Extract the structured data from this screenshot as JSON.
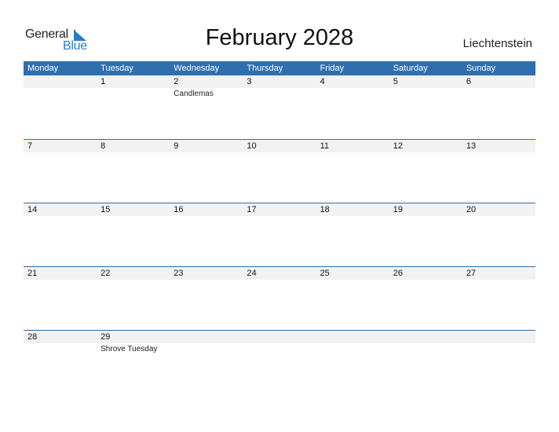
{
  "logo": {
    "word1": "General",
    "word2": "Blue"
  },
  "title": "February 2028",
  "country": "Liechtenstein",
  "colors": {
    "accent": "#2e6fb0",
    "logo_blue": "#2a7bc8",
    "row_shade": "#f2f2f2"
  },
  "weekdays": [
    "Monday",
    "Tuesday",
    "Wednesday",
    "Thursday",
    "Friday",
    "Saturday",
    "Sunday"
  ],
  "weeks": [
    {
      "days": [
        "",
        "1",
        "2",
        "3",
        "4",
        "5",
        "6"
      ],
      "events": [
        "",
        "",
        "Candlemas",
        "",
        "",
        "",
        ""
      ]
    },
    {
      "days": [
        "7",
        "8",
        "9",
        "10",
        "11",
        "12",
        "13"
      ],
      "events": [
        "",
        "",
        "",
        "",
        "",
        "",
        ""
      ]
    },
    {
      "days": [
        "14",
        "15",
        "16",
        "17",
        "18",
        "19",
        "20"
      ],
      "events": [
        "",
        "",
        "",
        "",
        "",
        "",
        ""
      ]
    },
    {
      "days": [
        "21",
        "22",
        "23",
        "24",
        "25",
        "26",
        "27"
      ],
      "events": [
        "",
        "",
        "",
        "",
        "",
        "",
        ""
      ]
    },
    {
      "days": [
        "28",
        "29",
        "",
        "",
        "",
        "",
        ""
      ],
      "events": [
        "",
        "Shrove Tuesday",
        "",
        "",
        "",
        "",
        ""
      ]
    }
  ]
}
